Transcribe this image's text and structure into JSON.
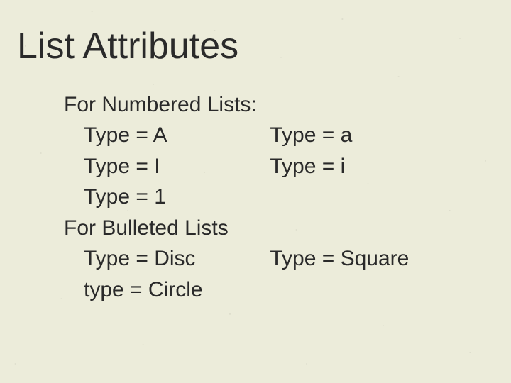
{
  "title": "List Attributes",
  "numbered": {
    "heading": "For Numbered Lists:",
    "row1_left": "Type = A",
    "row1_right": "Type = a",
    "row2_left": "Type = I",
    "row2_right": "Type = i",
    "row3_left": "Type = 1"
  },
  "bulleted": {
    "heading": "For Bulleted Lists",
    "row1_left": "Type = Disc",
    "row1_right": "Type = Square",
    "row2_left": "type = Circle"
  }
}
